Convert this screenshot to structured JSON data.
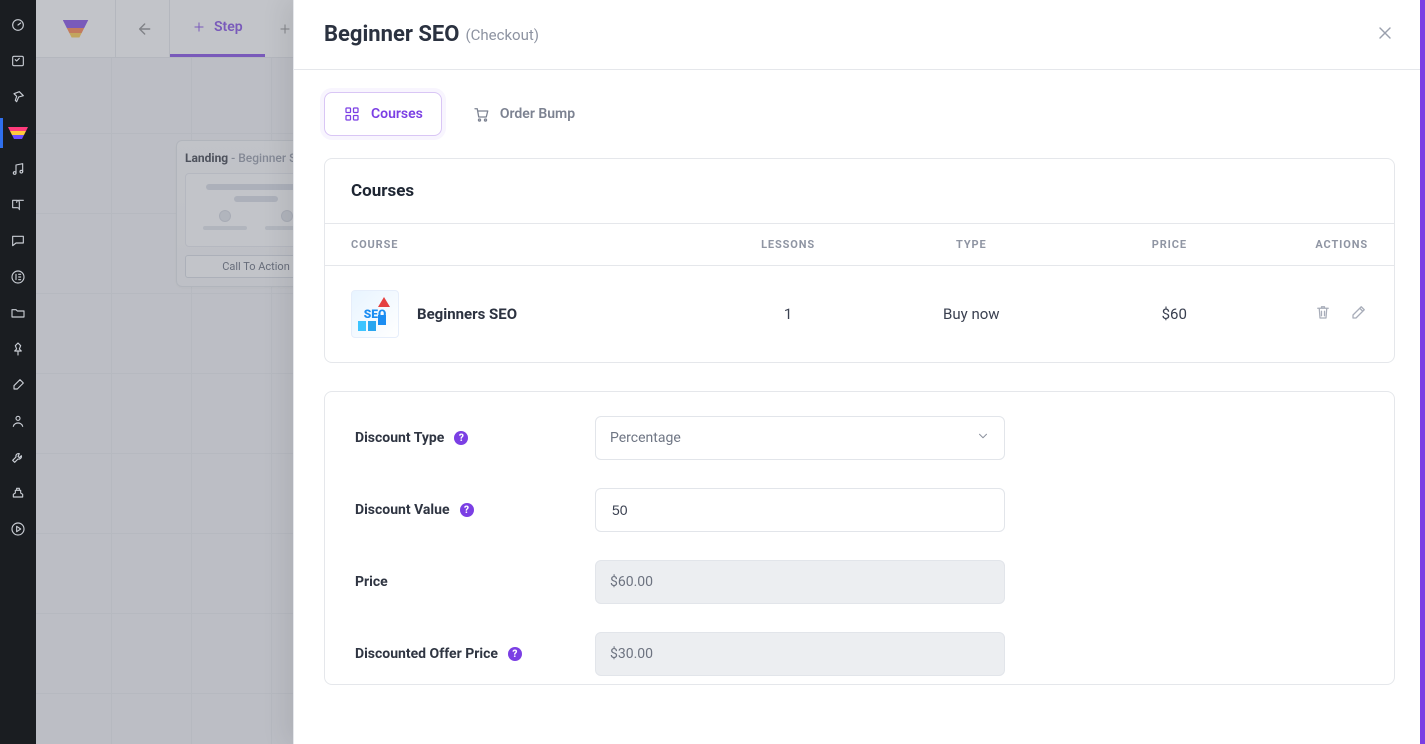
{
  "sidebar_icons": [
    "dashboard-icon",
    "checklist-icon",
    "pin-icon",
    "funnel-icon",
    "music-icon",
    "book-icon",
    "chat-icon",
    "elementor-icon",
    "folder-icon",
    "pushpin-icon",
    "paintbrush-icon",
    "user-icon",
    "wrench-icon",
    "power-icon",
    "play-icon"
  ],
  "topbar": {
    "step_tab": "Step"
  },
  "landing_card": {
    "step_name": "Landing",
    "step_sub": " - Beginner SEO",
    "cta": "Call To Action"
  },
  "panel": {
    "title": "Beginner SEO",
    "subtitle": "(Checkout)",
    "tabs": {
      "courses": "Courses",
      "order_bump": "Order Bump"
    },
    "courses_card": {
      "title": "Courses",
      "columns": {
        "course": "COURSE",
        "lessons": "LESSONS",
        "type": "TYPE",
        "price": "PRICE",
        "actions": "ACTIONS"
      },
      "rows": [
        {
          "name": "Beginners SEO",
          "thumb_text": "SEO",
          "lessons": "1",
          "type": "Buy now",
          "price": "$60"
        }
      ]
    },
    "form": {
      "discount_type": {
        "label": "Discount Type",
        "value": "Percentage"
      },
      "discount_value": {
        "label": "Discount Value",
        "value": "50"
      },
      "price": {
        "label": "Price",
        "value": "$60.00"
      },
      "discounted_offer": {
        "label": "Discounted Offer Price",
        "value": "$30.00"
      }
    }
  }
}
